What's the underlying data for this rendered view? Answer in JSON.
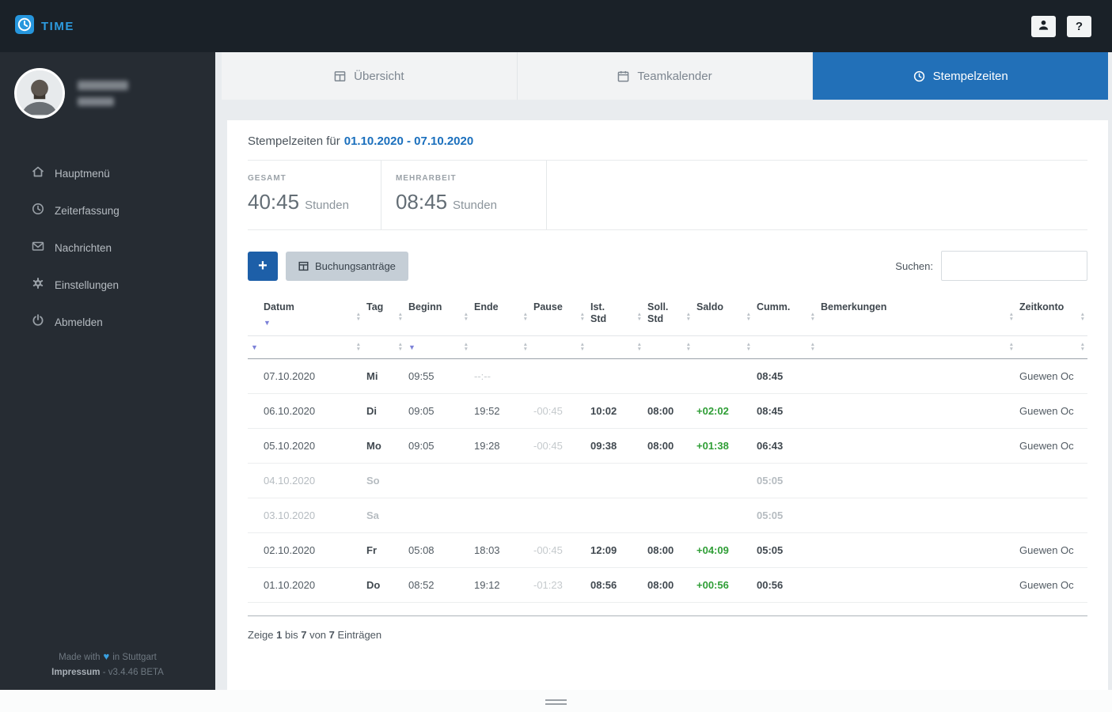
{
  "app": {
    "logo_text": "TIME"
  },
  "colors": {
    "accent_blue": "#2270b8",
    "logo_blue": "#2d9bdf",
    "positive_green": "#2f9e36",
    "dark_bar": "#1a2128"
  },
  "topbar": {
    "help_glyph": "?"
  },
  "sidebar": {
    "items": [
      {
        "icon": "home-icon",
        "label": "Hauptmenü"
      },
      {
        "icon": "clock-icon",
        "label": "Zeiterfassung"
      },
      {
        "icon": "mail-icon",
        "label": "Nachrichten"
      },
      {
        "icon": "gear-icon",
        "label": "Einstellungen"
      },
      {
        "icon": "power-icon",
        "label": "Abmelden"
      }
    ],
    "footer": {
      "made_prefix": "Made with",
      "made_suffix": "in Stuttgart",
      "link": "Impressum",
      "version": " - v3.4.46 BETA"
    }
  },
  "tabs": [
    {
      "label": "Übersicht",
      "active": false
    },
    {
      "label": "Teamkalender",
      "active": false
    },
    {
      "label": "Stempelzeiten",
      "active": true
    }
  ],
  "content": {
    "title_prefix": "Stempelzeiten für",
    "date_range": "01.10.2020 - 07.10.2020",
    "stats": [
      {
        "label": "GESAMT",
        "value": "40:45",
        "unit": "Stunden"
      },
      {
        "label": "MEHRARBEIT",
        "value": "08:45",
        "unit": "Stunden"
      }
    ],
    "toolbar": {
      "add_label": "+",
      "bookings_label": "Buchungsanträge",
      "search_label": "Suchen:",
      "search_value": ""
    },
    "table": {
      "columns": [
        "Datum",
        "Tag",
        "Beginn",
        "Ende",
        "Pause",
        "Ist.\nStd",
        "Soll.\nStd",
        "Saldo",
        "Cumm.",
        "Bemerkungen",
        "Zeitkonto"
      ],
      "rows": [
        {
          "datum": "07.10.2020",
          "tag": "Mi",
          "beginn": "09:55",
          "ende": "--:--",
          "pause": "",
          "ist": "",
          "soll": "",
          "saldo": "",
          "cumm": "08:45",
          "bemerkungen": "",
          "zeitkonto": "Guewen Oc",
          "muted": false
        },
        {
          "datum": "06.10.2020",
          "tag": "Di",
          "beginn": "09:05",
          "ende": "19:52",
          "pause": "-00:45",
          "ist": "10:02",
          "soll": "08:00",
          "saldo": "+02:02",
          "cumm": "08:45",
          "bemerkungen": "",
          "zeitkonto": "Guewen Oc",
          "muted": false
        },
        {
          "datum": "05.10.2020",
          "tag": "Mo",
          "beginn": "09:05",
          "ende": "19:28",
          "pause": "-00:45",
          "ist": "09:38",
          "soll": "08:00",
          "saldo": "+01:38",
          "cumm": "06:43",
          "bemerkungen": "",
          "zeitkonto": "Guewen Oc",
          "muted": false
        },
        {
          "datum": "04.10.2020",
          "tag": "So",
          "beginn": "",
          "ende": "",
          "pause": "",
          "ist": "",
          "soll": "",
          "saldo": "",
          "cumm": "05:05",
          "bemerkungen": "",
          "zeitkonto": "",
          "muted": true
        },
        {
          "datum": "03.10.2020",
          "tag": "Sa",
          "beginn": "",
          "ende": "",
          "pause": "",
          "ist": "",
          "soll": "",
          "saldo": "",
          "cumm": "05:05",
          "bemerkungen": "",
          "zeitkonto": "",
          "muted": true
        },
        {
          "datum": "02.10.2020",
          "tag": "Fr",
          "beginn": "05:08",
          "ende": "18:03",
          "pause": "-00:45",
          "ist": "12:09",
          "soll": "08:00",
          "saldo": "+04:09",
          "cumm": "05:05",
          "bemerkungen": "",
          "zeitkonto": "Guewen Oc",
          "muted": false
        },
        {
          "datum": "01.10.2020",
          "tag": "Do",
          "beginn": "08:52",
          "ende": "19:12",
          "pause": "-01:23",
          "ist": "08:56",
          "soll": "08:00",
          "saldo": "+00:56",
          "cumm": "00:56",
          "bemerkungen": "",
          "zeitkonto": "Guewen Oc",
          "muted": false
        }
      ],
      "info_parts": [
        "Zeige ",
        "1",
        " bis ",
        "7",
        " von ",
        "7",
        " Einträgen"
      ]
    }
  }
}
